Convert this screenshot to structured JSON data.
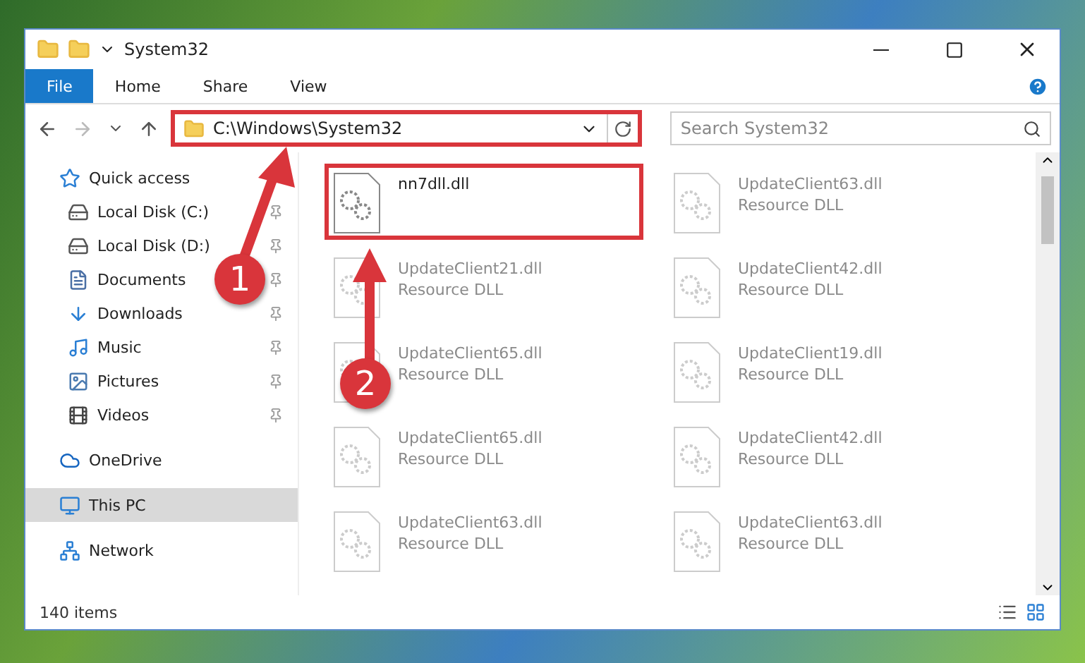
{
  "window": {
    "title": "System32"
  },
  "ribbon_tabs": [
    {
      "label": "File",
      "selected": true
    },
    {
      "label": "Home",
      "selected": false
    },
    {
      "label": "Share",
      "selected": false
    },
    {
      "label": "View",
      "selected": false
    }
  ],
  "address_bar": {
    "path": "C:\\Windows\\System32",
    "highlighted": true
  },
  "search": {
    "placeholder": "Search System32"
  },
  "sidebar": {
    "items": [
      {
        "label": "Quick access",
        "pinned": false,
        "selected": false,
        "children": [
          {
            "label": "Local Disk (C:)",
            "pinned": true,
            "selected": false
          },
          {
            "label": "Local Disk (D:)",
            "pinned": true,
            "selected": false
          },
          {
            "label": "Documents",
            "pinned": true,
            "selected": false
          },
          {
            "label": "Downloads",
            "pinned": true,
            "selected": false
          },
          {
            "label": "Music",
            "pinned": true,
            "selected": false
          },
          {
            "label": "Pictures",
            "pinned": true,
            "selected": false
          },
          {
            "label": "Videos",
            "pinned": true,
            "selected": false
          }
        ]
      },
      {
        "label": "OneDrive",
        "pinned": false,
        "selected": false
      },
      {
        "label": "This PC",
        "pinned": false,
        "selected": true
      },
      {
        "label": "Network",
        "pinned": false,
        "selected": false
      }
    ]
  },
  "files": [
    {
      "name": "nn7dll.dll",
      "faded": false,
      "highlighted": true
    },
    {
      "name": "UpdateClient63.dll",
      "type": "Resource DLL",
      "faded": true,
      "highlighted": false
    },
    {
      "name": "UpdateClient21.dll",
      "type": "Resource DLL",
      "faded": true,
      "highlighted": false
    },
    {
      "name": "UpdateClient42.dll",
      "type": "Resource DLL",
      "faded": true,
      "highlighted": false
    },
    {
      "name": "UpdateClient65.dll",
      "type": "Resource DLL",
      "faded": true,
      "highlighted": false
    },
    {
      "name": "UpdateClient19.dll",
      "type": "Resource DLL",
      "faded": true,
      "highlighted": false
    },
    {
      "name": "UpdateClient65.dll",
      "type": "Resource DLL",
      "faded": true,
      "highlighted": false
    },
    {
      "name": "UpdateClient42.dll",
      "type": "Resource DLL",
      "faded": true,
      "highlighted": false
    },
    {
      "name": "UpdateClient63.dll",
      "type": "Resource DLL",
      "faded": true,
      "highlighted": false
    },
    {
      "name": "UpdateClient63.dll",
      "type": "Resource DLL",
      "faded": true,
      "highlighted": false
    }
  ],
  "status_bar": {
    "count": "140 items"
  },
  "annotations": [
    {
      "number": "1"
    },
    {
      "number": "2"
    }
  ]
}
